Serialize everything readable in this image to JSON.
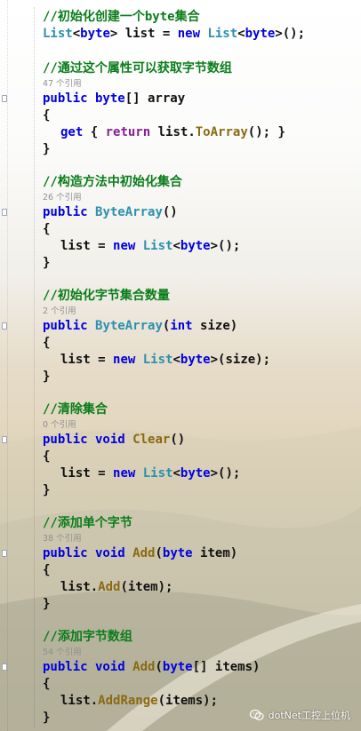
{
  "blocks": [
    {
      "comment": "//初始化创建一个byte集合",
      "lines": [
        [
          {
            "t": "type",
            "v": "List"
          },
          {
            "t": "plain",
            "v": "<"
          },
          {
            "t": "kw",
            "v": "byte"
          },
          {
            "t": "plain",
            "v": "> list = "
          },
          {
            "t": "kw",
            "v": "new "
          },
          {
            "t": "type",
            "v": "List"
          },
          {
            "t": "plain",
            "v": "<"
          },
          {
            "t": "kw",
            "v": "byte"
          },
          {
            "t": "plain",
            "v": ">();"
          }
        ]
      ]
    },
    {
      "comment": "//通过这个属性可以获取字节数组",
      "refs": "47 个引用",
      "lines": [
        [
          {
            "t": "kw",
            "v": "public byte"
          },
          {
            "t": "plain",
            "v": "[] array"
          }
        ],
        [
          {
            "t": "plain",
            "v": "{"
          }
        ],
        [
          {
            "t": "kw",
            "v": "get"
          },
          {
            "t": "plain",
            "v": " { "
          },
          {
            "t": "ctl",
            "v": "return"
          },
          {
            "t": "plain",
            "v": " list."
          },
          {
            "t": "fn",
            "v": "ToArray"
          },
          {
            "t": "plain",
            "v": "(); }"
          }
        ],
        [
          {
            "t": "plain",
            "v": "}"
          }
        ]
      ],
      "indent": [
        2
      ]
    },
    {
      "comment": "//构造方法中初始化集合",
      "refs": "26 个引用",
      "lines": [
        [
          {
            "t": "kw",
            "v": "public "
          },
          {
            "t": "type",
            "v": "ByteArray"
          },
          {
            "t": "plain",
            "v": "()"
          }
        ],
        [
          {
            "t": "plain",
            "v": "{"
          }
        ],
        [
          {
            "t": "plain",
            "v": "list = "
          },
          {
            "t": "kw",
            "v": "new "
          },
          {
            "t": "type",
            "v": "List"
          },
          {
            "t": "plain",
            "v": "<"
          },
          {
            "t": "kw",
            "v": "byte"
          },
          {
            "t": "plain",
            "v": ">();"
          }
        ],
        [
          {
            "t": "plain",
            "v": "}"
          }
        ]
      ],
      "indent": [
        2
      ]
    },
    {
      "comment": "//初始化字节集合数量",
      "refs": "2 个引用",
      "lines": [
        [
          {
            "t": "kw",
            "v": "public "
          },
          {
            "t": "type",
            "v": "ByteArray"
          },
          {
            "t": "plain",
            "v": "("
          },
          {
            "t": "kw",
            "v": "int"
          },
          {
            "t": "plain",
            "v": " size)"
          }
        ],
        [
          {
            "t": "plain",
            "v": "{"
          }
        ],
        [
          {
            "t": "plain",
            "v": "list = "
          },
          {
            "t": "kw",
            "v": "new "
          },
          {
            "t": "type",
            "v": "List"
          },
          {
            "t": "plain",
            "v": "<"
          },
          {
            "t": "kw",
            "v": "byte"
          },
          {
            "t": "plain",
            "v": ">(size);"
          }
        ],
        [
          {
            "t": "plain",
            "v": "}"
          }
        ]
      ],
      "indent": [
        2
      ]
    },
    {
      "comment": "//清除集合",
      "refs": "0 个引用",
      "lines": [
        [
          {
            "t": "kw",
            "v": "public void "
          },
          {
            "t": "fn",
            "v": "Clear"
          },
          {
            "t": "plain",
            "v": "()"
          }
        ],
        [
          {
            "t": "plain",
            "v": "{"
          }
        ],
        [
          {
            "t": "plain",
            "v": "list = "
          },
          {
            "t": "kw",
            "v": "new "
          },
          {
            "t": "type",
            "v": "List"
          },
          {
            "t": "plain",
            "v": "<"
          },
          {
            "t": "kw",
            "v": "byte"
          },
          {
            "t": "plain",
            "v": ">();"
          }
        ],
        [
          {
            "t": "plain",
            "v": "}"
          }
        ]
      ],
      "indent": [
        2
      ]
    },
    {
      "comment": "//添加单个字节",
      "refs": "38 个引用",
      "lines": [
        [
          {
            "t": "kw",
            "v": "public void "
          },
          {
            "t": "fn",
            "v": "Add"
          },
          {
            "t": "plain",
            "v": "("
          },
          {
            "t": "kw",
            "v": "byte"
          },
          {
            "t": "plain",
            "v": " item)"
          }
        ],
        [
          {
            "t": "plain",
            "v": "{"
          }
        ],
        [
          {
            "t": "plain",
            "v": "list."
          },
          {
            "t": "fn",
            "v": "Add"
          },
          {
            "t": "plain",
            "v": "(item);"
          }
        ],
        [
          {
            "t": "plain",
            "v": "}"
          }
        ]
      ],
      "indent": [
        2
      ]
    },
    {
      "comment": "//添加字节数组",
      "refs": "54 个引用",
      "lines": [
        [
          {
            "t": "kw",
            "v": "public void "
          },
          {
            "t": "fn",
            "v": "Add"
          },
          {
            "t": "plain",
            "v": "("
          },
          {
            "t": "kw",
            "v": "byte"
          },
          {
            "t": "plain",
            "v": "[] items)"
          }
        ],
        [
          {
            "t": "plain",
            "v": "{"
          }
        ],
        [
          {
            "t": "plain",
            "v": "list."
          },
          {
            "t": "fn",
            "v": "AddRange"
          },
          {
            "t": "plain",
            "v": "(items);"
          }
        ],
        [
          {
            "t": "plain",
            "v": "}"
          }
        ]
      ],
      "indent": [
        2
      ]
    }
  ],
  "watermark": {
    "icon": "wechat-icon",
    "text": "dotNet工控上位机"
  },
  "colors": {
    "keyword": "#0000e0",
    "control": "#8b1c9a",
    "type": "#2b91af",
    "method": "#8a6a12",
    "comment": "#0a7d1a",
    "refs": "#8f8f8f"
  }
}
